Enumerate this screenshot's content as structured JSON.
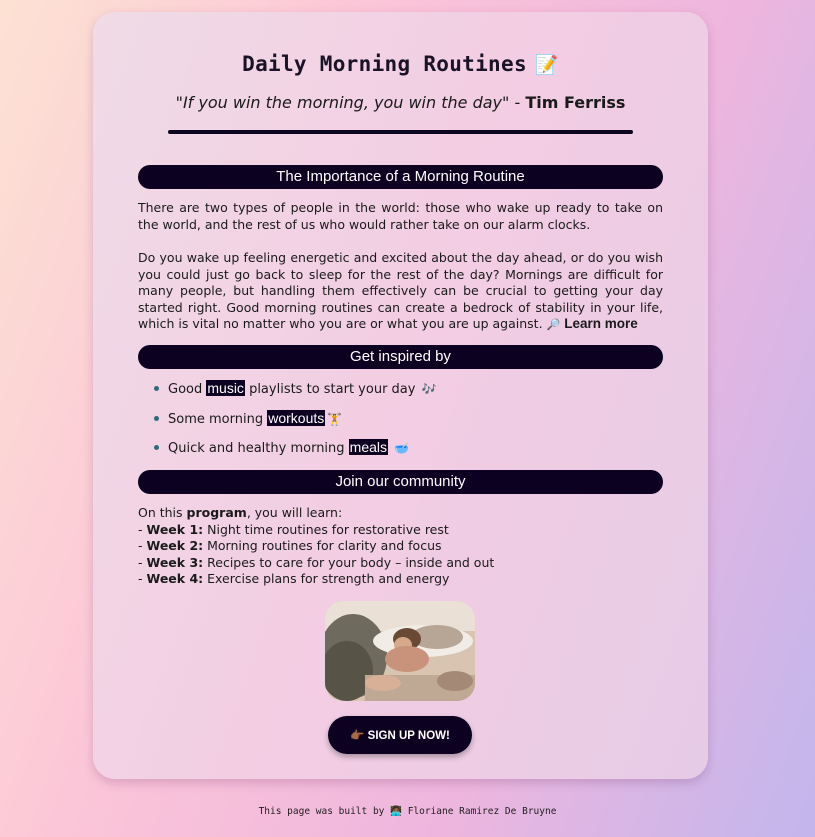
{
  "header": {
    "title": "Daily Morning Routines",
    "title_icon": "📝",
    "quote_text": "\"If you win the morning, you win the day\"",
    "quote_separator": " - ",
    "quote_author": "Tim Ferriss"
  },
  "sections": {
    "importance": "The Importance of a Morning Routine",
    "inspired": "Get inspired by",
    "community": "Join our community"
  },
  "importance": {
    "paragraph1": "There are two types of people in the world: those who wake up ready to take on the world, and the rest of us who would rather take on our alarm clocks.",
    "paragraph2": "Do you wake up feeling energetic and excited about the day ahead, or do you wish you could just go back to sleep for the rest of the day? Mornings are difficult for many people, but handling them effectively can be crucial to getting your day started right. Good morning routines can create a bedrock of stability in your life, which is vital no matter who you are or what you are up against.",
    "learn_more_icon": "🔎",
    "learn_more": "Learn more"
  },
  "inspired_items": [
    {
      "before": "Good ",
      "highlight": "music",
      "after": " playlists to start your day ",
      "emoji": "🎶"
    },
    {
      "before": "Some morning ",
      "highlight": "workouts",
      "after": "",
      "emoji": "🏋"
    },
    {
      "before": "Quick and healthy morning ",
      "highlight": "meals",
      "after": " ",
      "emoji": "🥣"
    }
  ],
  "community": {
    "intro_before": "On this ",
    "intro_bold": "program",
    "intro_after": ", you will learn:",
    "weeks": [
      {
        "label": "Week 1:",
        "text": " Night time routines for restorative rest"
      },
      {
        "label": "Week 2:",
        "text": " Morning routines for clarity and focus"
      },
      {
        "label": "Week 3:",
        "text": " Recipes to care for your body – inside and out"
      },
      {
        "label": "Week 4:",
        "text": " Exercise plans for strength and energy"
      }
    ]
  },
  "signup": {
    "icon": "👉🏾",
    "label": "SIGN UP NOW!"
  },
  "footer": {
    "prefix": "This page was built by ",
    "icon": "👩🏾‍💻",
    "author": " Floriane Ramirez De Bruyne"
  },
  "colors": {
    "accent_dark": "#0c0120",
    "card": "#f0dbe6"
  }
}
